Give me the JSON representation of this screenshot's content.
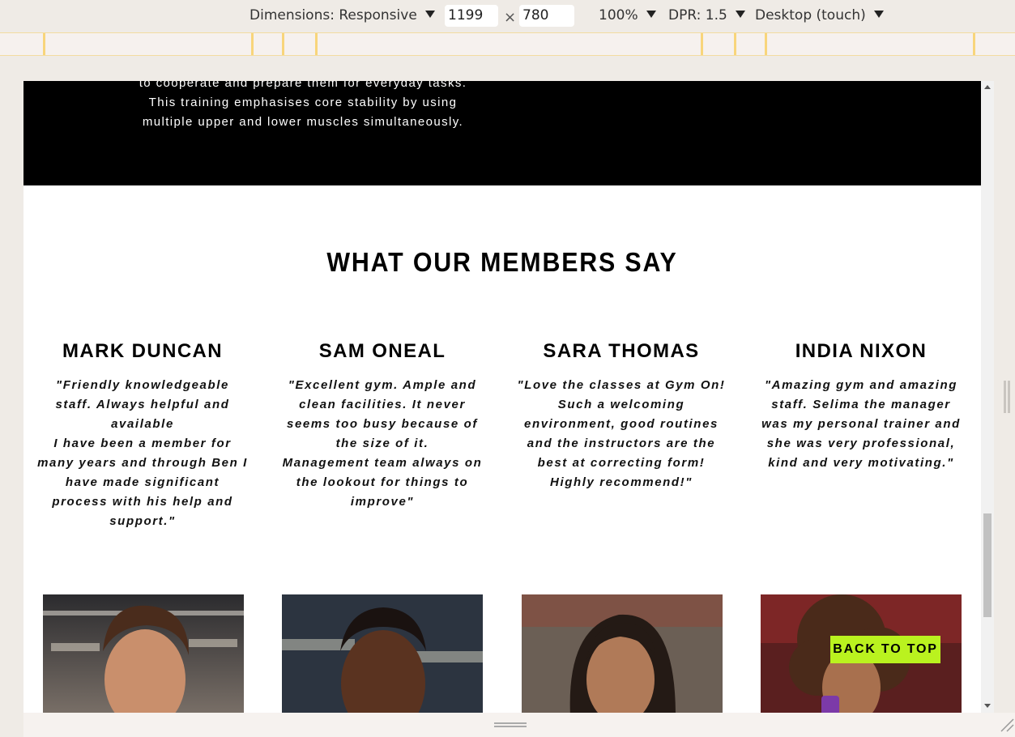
{
  "device_toolbar": {
    "dimensions_label": "Dimensions: Responsive",
    "width_value": "1199",
    "times": "×",
    "height_value": "780",
    "zoom": "100%",
    "dpr": "DPR: 1.5",
    "device_mode": "Desktop (touch)"
  },
  "hero": {
    "text_lines": [
      "to cooperate and prepare them for everyday tasks.",
      "This training emphasises core stability by using",
      "multiple upper and lower muscles simultaneously."
    ]
  },
  "testimonials": {
    "title": "WHAT OUR MEMBERS SAY",
    "items": [
      {
        "name": "MARK DUNCAN",
        "quote": "\"Friendly knowledgeable\nstaff. Always helpful and\navailable\nI have been a member for\nmany years and through Ben I\nhave made significant\nprocess with his help and\nsupport.\""
      },
      {
        "name": "SAM ONEAL",
        "quote": "\"Excellent gym. Ample and\nclean facilities. It never\nseems too busy because of\nthe size of it.\nManagement team always on\nthe lookout for things to\nimprove\""
      },
      {
        "name": "SARA THOMAS",
        "quote": "\"Love the classes at Gym On!\nSuch a welcoming\nenvironment, good routines\nand the instructors are the\nbest at correcting form!\nHighly recommend!\""
      },
      {
        "name": "INDIA NIXON",
        "quote": "\"Amazing gym and amazing\nstaff. Selima the manager\nwas my personal trainer and\nshe was very professional,\nkind and very motivating.\""
      }
    ]
  },
  "back_to_top": "BACK TO TOP",
  "colors": {
    "accent": "#baf21f",
    "hero_bg": "#000000"
  }
}
